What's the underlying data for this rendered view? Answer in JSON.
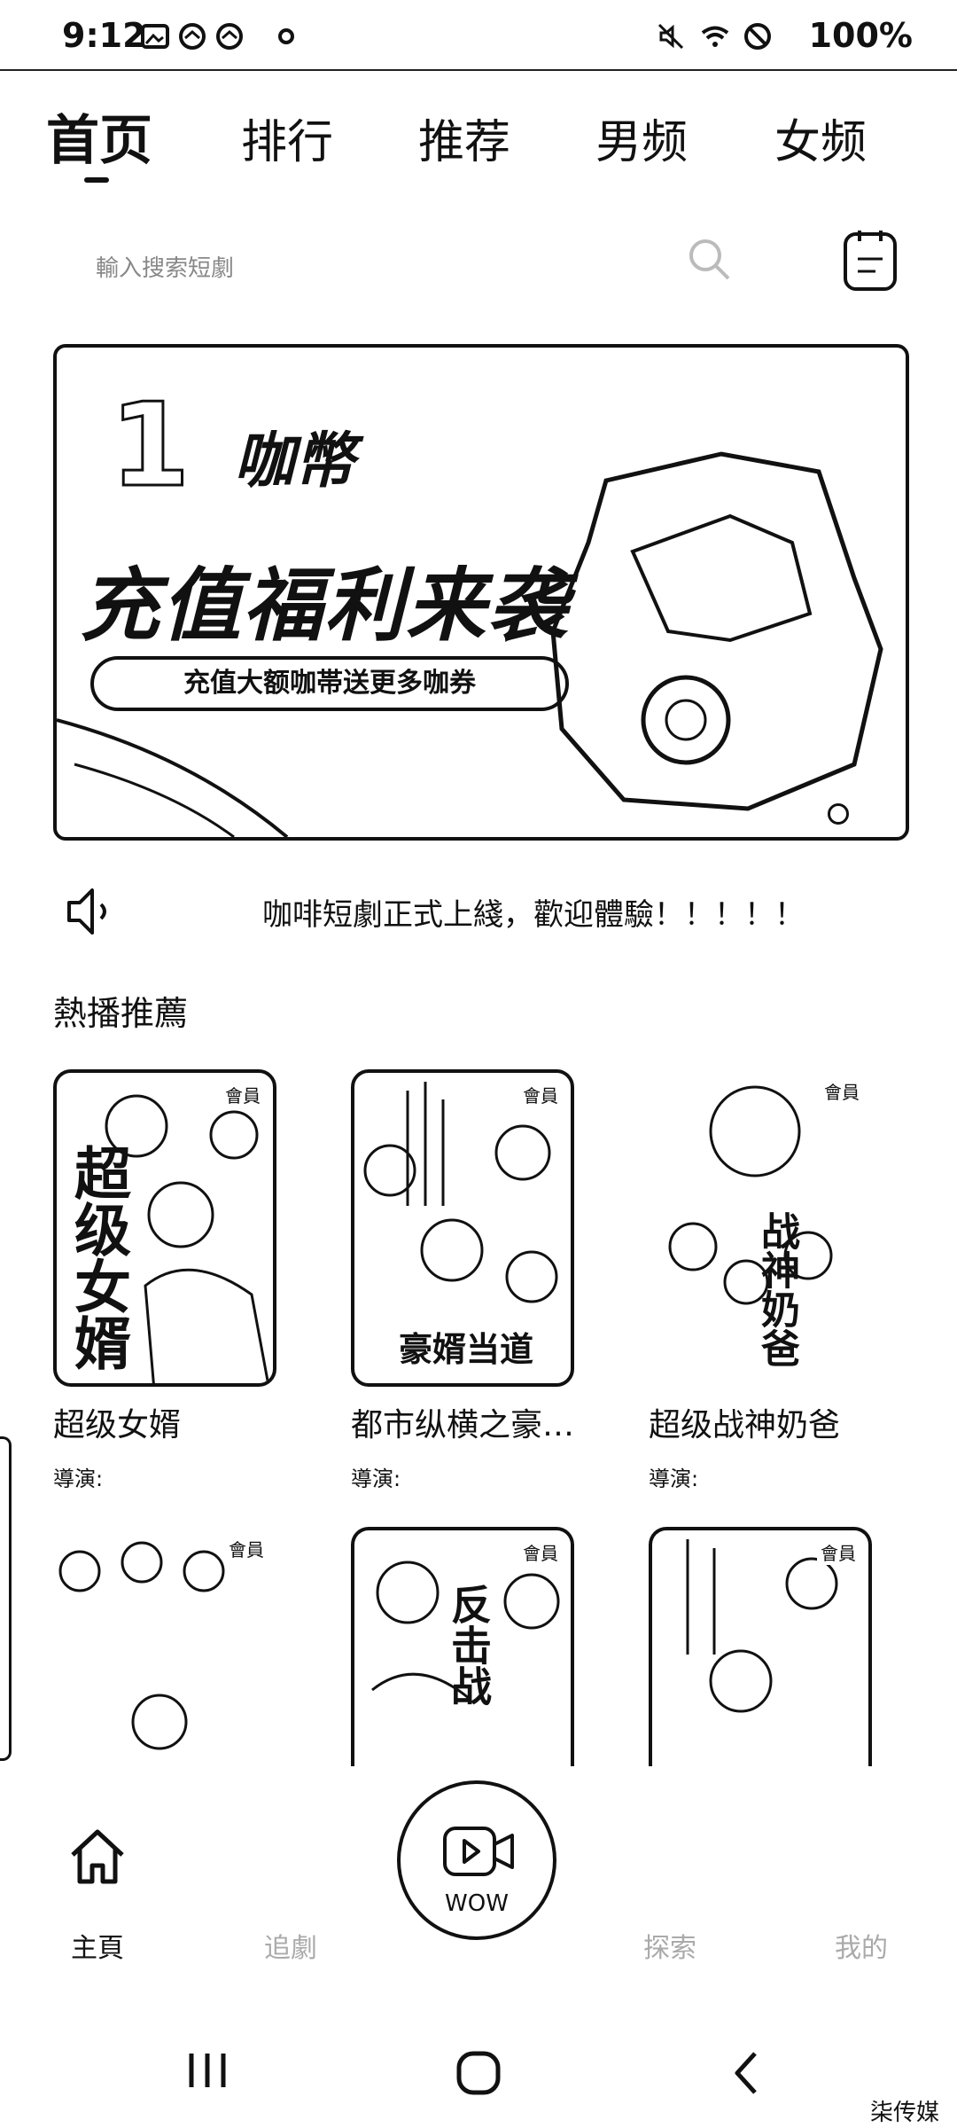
{
  "status_bar": {
    "time": "9:12",
    "battery": "100%"
  },
  "top_tabs": [
    "首页",
    "排行",
    "推荐",
    "男频",
    "女频"
  ],
  "search": {
    "placeholder": "輸入搜索短劇"
  },
  "banner": {
    "top_text": "咖幣",
    "headline": "充值福利来袭",
    "pill_text": "充值大额咖帯送更多咖券"
  },
  "notice": {
    "text": "咖啡短劇正式上綫，歡迎體驗！！！！！"
  },
  "section": {
    "title": "熱播推薦"
  },
  "cards": [
    {
      "badge": "會員",
      "title": "超级女婿",
      "poster_text": "超级女婿",
      "caption": "",
      "director_label": "導演:"
    },
    {
      "badge": "會員",
      "title": "都市纵横之豪…",
      "poster_text": "",
      "caption": "豪婿当道",
      "director_label": "導演:"
    },
    {
      "badge": "會員",
      "title": "超级战神奶爸",
      "poster_text": "战神奶爸",
      "caption": "",
      "director_label": "導演:"
    },
    {
      "badge": "會員",
      "title": "",
      "poster_text": "",
      "caption": ""
    },
    {
      "badge": "會員",
      "title": "",
      "poster_text": "反击战",
      "caption": ""
    },
    {
      "badge": "會員",
      "title": "",
      "poster_text": "",
      "caption": ""
    }
  ],
  "bottom_nav": {
    "home": "主頁",
    "follow": "追劇",
    "fab": "WOW",
    "discover": "探索",
    "mine": "我的"
  },
  "watermark": "柒传媒"
}
